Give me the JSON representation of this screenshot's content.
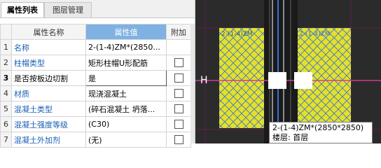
{
  "tabs": {
    "active": "属性列表",
    "inactive": "图层管理"
  },
  "table": {
    "headers": [
      "",
      "属性名称",
      "属性值",
      "附加"
    ],
    "rows": [
      {
        "num": "1",
        "name": "名称",
        "value": "2-(1-4)ZM*(2850...",
        "blue": true
      },
      {
        "num": "2",
        "name": "柱帽类型",
        "value": "矩形柱帽U形配筋",
        "blue": true
      },
      {
        "num": "3",
        "name": "是否按板边切割",
        "value": "是",
        "blue": false
      },
      {
        "num": "4",
        "name": "材质",
        "value": "现浇混凝土",
        "blue": true
      },
      {
        "num": "5",
        "name": "混凝土类型",
        "value": "(碎石混凝土 坍落...",
        "blue": true
      },
      {
        "num": "6",
        "name": "混凝土强度等级",
        "value": "(C30)",
        "blue": true
      },
      {
        "num": "7",
        "name": "混凝土外加剂",
        "value": "(无)",
        "blue": true
      }
    ]
  },
  "view": {
    "axis_label": "H",
    "element_label_left": "2-(1-4)ZM",
    "element_label_right": "2-(1-4)ZM",
    "tooltip_line1": "2-(1-4)ZM*(2850*2850)",
    "tooltip_line2": "楼层: 首层"
  },
  "colors": {
    "column_fill": "#e3e12a",
    "hatch": "#3a6fd8",
    "magenta_line": "#d63a8e",
    "grid_line": "#6d1f54"
  }
}
